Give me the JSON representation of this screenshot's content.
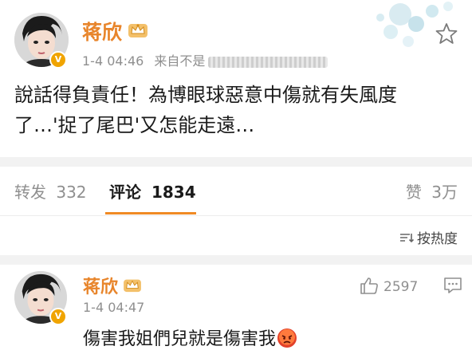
{
  "post": {
    "username": "蒋欣",
    "meta_time": "1-4 04:46",
    "meta_source_prefix": "来自不是",
    "text_line1": "說話得負責任！為博眼球惡意中傷就有失風度",
    "text_line2": "了…'捉了尾巴'又怎能走遠…",
    "avatar_icon": "avatar-image",
    "verified_icon": "verified-v-icon",
    "crown_icon": "crown-member-icon",
    "star_icon": "star-favorite-icon"
  },
  "tabs": {
    "repost_label": "转发",
    "repost_count": "332",
    "comment_label": "评论",
    "comment_count": "1834",
    "like_label": "赞",
    "like_count": "3万"
  },
  "sort": {
    "label": "按热度",
    "icon": "sort-icon"
  },
  "comment": {
    "username": "蒋欣",
    "time": "1-4 04:47",
    "likes": "2597",
    "text": "傷害我姐們兒就是傷害我",
    "emoji": "angry-face-emoji"
  },
  "colors": {
    "accent": "#e8852b",
    "tab_underline": "#f08a24",
    "muted": "#8f8f8f",
    "separator": "#f2f2f2"
  }
}
